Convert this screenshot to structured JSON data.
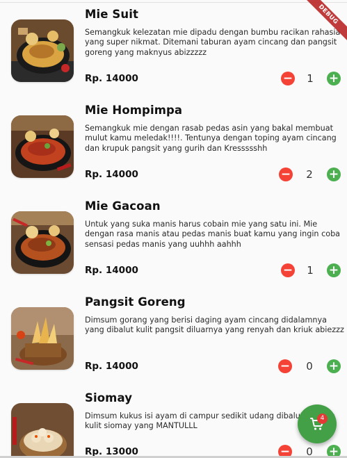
{
  "debug_banner": "DEBUG",
  "colors": {
    "minus": "#f44336",
    "plus": "#4caf50",
    "fab": "#43a047",
    "badge": "#e53935"
  },
  "icons": {
    "minus": "minus-icon",
    "plus": "plus-icon",
    "cart": "cart-icon"
  },
  "cart": {
    "count": "4"
  },
  "menu": [
    {
      "name": "Mie Suit",
      "description": "Semangkuk kelezatan mie dipadu dengan bumbu racikan rahasia yang super nikmat. Ditemani taburan ayam cincang dan pangsit goreng yang maknyus abizzzzz",
      "price": "Rp. 14000",
      "qty": "1",
      "minus": "−",
      "plus": "+"
    },
    {
      "name": "Mie Hompimpa",
      "description": "Semangkuk mie dengan rasab pedas asin yang bakal membuat mulut kamu meledak!!!!. Tentunya dengan toping ayam cincang dan krupuk pangsit yang gurih dan Kressssshh",
      "price": "Rp. 14000",
      "qty": "2",
      "minus": "−",
      "plus": "+"
    },
    {
      "name": "Mie Gacoan",
      "description": "Untuk yang suka manis harus cobain mie yang satu ini. Mie dengan rasa manis atau pedas manis buat kamu yang ingin coba sensasi pedas manis yang uuhhh aahhh",
      "price": "Rp. 14000",
      "qty": "1",
      "minus": "−",
      "plus": "+"
    },
    {
      "name": "Pangsit Goreng",
      "description": "Dimsum gorang yang berisi daging ayam cincang didalamnya yang dibalut kulit pangsit diluarnya yang renyah dan kriuk abiezzz",
      "price": "Rp. 14000",
      "qty": "0",
      "minus": "−",
      "plus": "+"
    },
    {
      "name": "Siomay",
      "description": "Dimsum kukus isi ayam di campur sedikit udang dibalut dengan kulit siomay yang MANTULLL",
      "price": "Rp. 13000",
      "qty": "0",
      "minus": "−",
      "plus": "+"
    }
  ]
}
